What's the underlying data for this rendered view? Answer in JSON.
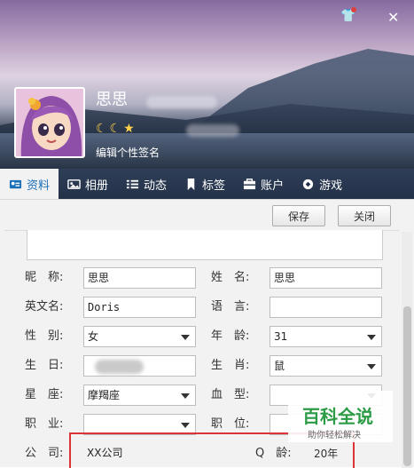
{
  "header": {
    "nickname": "思思",
    "level_icons": "☾☾★",
    "signature": "编辑个性签名"
  },
  "tabs": [
    {
      "label": "资料",
      "icon": "profile-card-icon"
    },
    {
      "label": "相册",
      "icon": "photo-album-icon"
    },
    {
      "label": "动态",
      "icon": "feed-list-icon"
    },
    {
      "label": "标签",
      "icon": "bookmark-icon"
    },
    {
      "label": "账户",
      "icon": "wallet-icon"
    },
    {
      "label": "游戏",
      "icon": "game-icon"
    }
  ],
  "toolbar": {
    "save_label": "保存",
    "close_label": "关闭"
  },
  "form": {
    "nickname_label": "昵　称:",
    "nickname_value": "思思",
    "surname_label": "姓　名:",
    "surname_value": "思思",
    "english_label": "英文名:",
    "english_value": "Doris",
    "language_label": "语　言:",
    "language_value": "",
    "gender_label": "性　别:",
    "gender_value": "女",
    "age_label": "年　龄:",
    "age_value": "31",
    "birthday_label": "生　日:",
    "zodiac_label": "生　肖:",
    "zodiac_value": "鼠",
    "sign_label": "星　座:",
    "sign_value": "摩羯座",
    "blood_label": "血　型:",
    "blood_value": "",
    "job_label": "职　业:",
    "job_value": "",
    "position_label": "职　位:",
    "company_label": "公　司:",
    "company_value": "XX公司",
    "q_age_label": "Q　龄:",
    "q_age_value": "20年"
  },
  "watermark": {
    "title": "百科全说",
    "subtitle": "助你轻松解决"
  }
}
